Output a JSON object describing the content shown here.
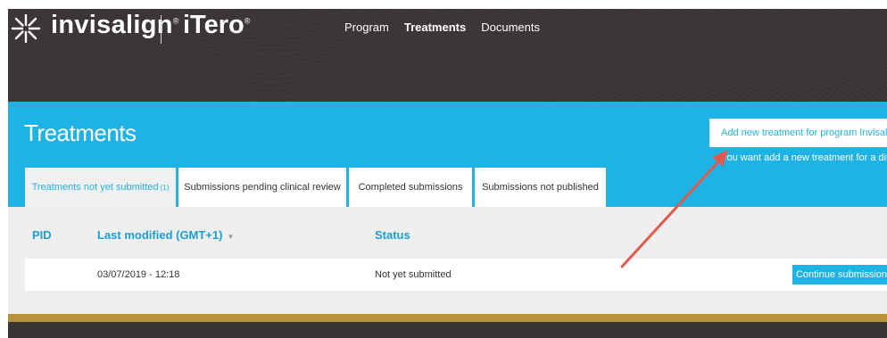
{
  "header": {
    "brand": "invisalign",
    "brand_reg": "®",
    "product": "iTero",
    "product_reg": "®",
    "nav": [
      {
        "label": "Program",
        "active": false
      },
      {
        "label": "Treatments",
        "active": true
      },
      {
        "label": "Documents",
        "active": false
      }
    ]
  },
  "hero": {
    "title": "Treatments",
    "add_button": "Add new treatment for program Invisalign",
    "hint": "you want add a new treatment for a differ"
  },
  "tabs": [
    {
      "label": "Treatments not yet submitted",
      "count": "(1)",
      "active": true
    },
    {
      "label": "Submissions pending clinical review",
      "active": false
    },
    {
      "label": "Completed submissions",
      "active": false
    },
    {
      "label": "Submissions not published",
      "active": false
    }
  ],
  "table": {
    "headers": {
      "pid": "PID",
      "last_modified": "Last modified (GMT+1)",
      "sort_icon": "▼",
      "status": "Status"
    },
    "rows": [
      {
        "pid": "",
        "last_modified": "03/07/2019 - 12:18",
        "status": "Not yet submitted",
        "action": "Continue submission"
      }
    ]
  },
  "colors": {
    "accent": "#1fb3e5",
    "dark": "#3a3534",
    "gold": "#b9913c",
    "annotation": "#e05a4e"
  }
}
